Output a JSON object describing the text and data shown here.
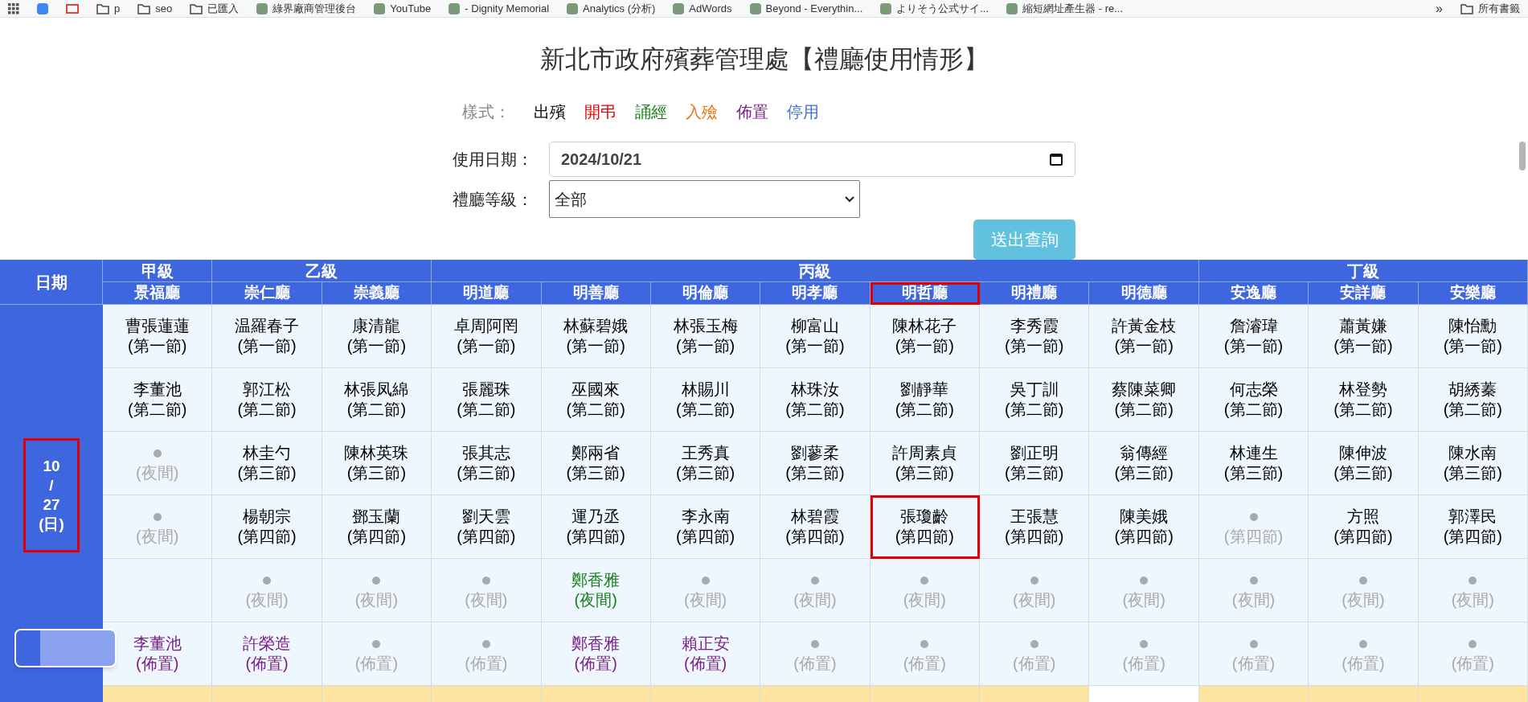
{
  "bookmarks": [
    {
      "kind": "folder",
      "label": "p"
    },
    {
      "kind": "folder",
      "label": "seo"
    },
    {
      "kind": "folder",
      "label": "已匯入"
    },
    {
      "kind": "site",
      "label": "綠界廠商管理後台"
    },
    {
      "kind": "site",
      "label": "YouTube"
    },
    {
      "kind": "site",
      "label": "- Dignity Memorial"
    },
    {
      "kind": "site",
      "label": "Analytics (分析)"
    },
    {
      "kind": "site",
      "label": "AdWords"
    },
    {
      "kind": "site",
      "label": "Beyond - Everythin..."
    },
    {
      "kind": "site",
      "label": "よりそう公式サイ..."
    },
    {
      "kind": "site",
      "label": "縮短網址產生器 - re..."
    }
  ],
  "bookmarks_more": "»",
  "bookmarks_all": "所有書籤",
  "title": "新北市政府殯葬管理處【禮廳使用情形】",
  "legend": {
    "label": "樣式：",
    "items": [
      {
        "label": "出殯",
        "color": "#000000"
      },
      {
        "label": "開弔",
        "color": "#e00000"
      },
      {
        "label": "誦經",
        "color": "#1a7f1a"
      },
      {
        "label": "入殮",
        "color": "#e8730c"
      },
      {
        "label": "佈置",
        "color": "#7a1f86"
      },
      {
        "label": "停用",
        "color": "#3a6fd8"
      }
    ]
  },
  "date_field": {
    "label": "使用日期：",
    "value": "2024/10/21"
  },
  "level_field": {
    "label": "禮廳等級：",
    "value": "全部"
  },
  "submit": "送出查詢",
  "table": {
    "date_header": "日期",
    "groups": [
      {
        "label": "甲級",
        "halls": [
          {
            "label": "景福廳",
            "highlighted": false
          }
        ]
      },
      {
        "label": "乙級",
        "halls": [
          {
            "label": "崇仁廳",
            "highlighted": false
          },
          {
            "label": "崇義廳",
            "highlighted": false
          }
        ]
      },
      {
        "label": "丙級",
        "halls": [
          {
            "label": "明道廳",
            "highlighted": false
          },
          {
            "label": "明善廳",
            "highlighted": false
          },
          {
            "label": "明倫廳",
            "highlighted": false
          },
          {
            "label": "明孝廳",
            "highlighted": false
          },
          {
            "label": "明哲廳",
            "highlighted": true
          },
          {
            "label": "明禮廳",
            "highlighted": false
          },
          {
            "label": "明德廳",
            "highlighted": false
          }
        ]
      },
      {
        "label": "丁級",
        "halls": [
          {
            "label": "安逸廳",
            "highlighted": false
          },
          {
            "label": "安詳廳",
            "highlighted": false
          },
          {
            "label": "安樂廳",
            "highlighted": false
          }
        ]
      }
    ],
    "date": {
      "lines": [
        "10",
        "/",
        "27",
        "(日)"
      ],
      "highlighted": true
    },
    "rows": [
      {
        "cells": [
          {
            "kind": "booked",
            "name": "曹張蓮蓮",
            "session": "(第一節)",
            "color": "#000000",
            "highlighted": false
          },
          {
            "kind": "booked",
            "name": "温羅春子",
            "session": "(第一節)",
            "color": "#000000",
            "highlighted": false
          },
          {
            "kind": "booked",
            "name": "康清龍",
            "session": "(第一節)",
            "color": "#000000",
            "highlighted": false
          },
          {
            "kind": "booked",
            "name": "卓周阿罔",
            "session": "(第一節)",
            "color": "#000000",
            "highlighted": false
          },
          {
            "kind": "booked",
            "name": "林蘇碧娥",
            "session": "(第一節)",
            "color": "#000000",
            "highlighted": false
          },
          {
            "kind": "booked",
            "name": "林張玉梅",
            "session": "(第一節)",
            "color": "#000000",
            "highlighted": false
          },
          {
            "kind": "booked",
            "name": "柳富山",
            "session": "(第一節)",
            "color": "#000000",
            "highlighted": false
          },
          {
            "kind": "booked",
            "name": "陳林花子",
            "session": "(第一節)",
            "color": "#000000",
            "highlighted": false
          },
          {
            "kind": "booked",
            "name": "李秀霞",
            "session": "(第一節)",
            "color": "#000000",
            "highlighted": false
          },
          {
            "kind": "booked",
            "name": "許黃金枝",
            "session": "(第一節)",
            "color": "#000000",
            "highlighted": false
          },
          {
            "kind": "booked",
            "name": "詹濬瑋",
            "session": "(第一節)",
            "color": "#000000",
            "highlighted": false
          },
          {
            "kind": "booked",
            "name": "蕭黃嫌",
            "session": "(第一節)",
            "color": "#000000",
            "highlighted": false
          },
          {
            "kind": "booked",
            "name": "陳怡勳",
            "session": "(第一節)",
            "color": "#000000",
            "highlighted": false
          }
        ]
      },
      {
        "cells": [
          {
            "kind": "booked",
            "name": "李董池",
            "session": "(第二節)",
            "color": "#000000",
            "highlighted": false
          },
          {
            "kind": "booked",
            "name": "郭江松",
            "session": "(第二節)",
            "color": "#000000",
            "highlighted": false
          },
          {
            "kind": "booked",
            "name": "林張凤綿",
            "session": "(第二節)",
            "color": "#000000",
            "highlighted": false
          },
          {
            "kind": "booked",
            "name": "張麗珠",
            "session": "(第二節)",
            "color": "#000000",
            "highlighted": false
          },
          {
            "kind": "booked",
            "name": "巫國來",
            "session": "(第二節)",
            "color": "#000000",
            "highlighted": false
          },
          {
            "kind": "booked",
            "name": "林賜川",
            "session": "(第二節)",
            "color": "#000000",
            "highlighted": false
          },
          {
            "kind": "booked",
            "name": "林珠汝",
            "session": "(第二節)",
            "color": "#000000",
            "highlighted": false
          },
          {
            "kind": "booked",
            "name": "劉靜華",
            "session": "(第二節)",
            "color": "#000000",
            "highlighted": false
          },
          {
            "kind": "booked",
            "name": "吳丁訓",
            "session": "(第二節)",
            "color": "#000000",
            "highlighted": false
          },
          {
            "kind": "booked",
            "name": "蔡陳菜卿",
            "session": "(第二節)",
            "color": "#000000",
            "highlighted": false
          },
          {
            "kind": "booked",
            "name": "何志榮",
            "session": "(第二節)",
            "color": "#000000",
            "highlighted": false
          },
          {
            "kind": "booked",
            "name": "林登勢",
            "session": "(第二節)",
            "color": "#000000",
            "highlighted": false
          },
          {
            "kind": "booked",
            "name": "胡綉蓁",
            "session": "(第二節)",
            "color": "#000000",
            "highlighted": false
          }
        ]
      },
      {
        "cells": [
          {
            "kind": "empty",
            "session": "(夜間)",
            "highlighted": false
          },
          {
            "kind": "booked",
            "name": "林圭勺",
            "session": "(第三節)",
            "color": "#000000",
            "highlighted": false
          },
          {
            "kind": "booked",
            "name": "陳林英珠",
            "session": "(第三節)",
            "color": "#000000",
            "highlighted": false
          },
          {
            "kind": "booked",
            "name": "張其志",
            "session": "(第三節)",
            "color": "#000000",
            "highlighted": false
          },
          {
            "kind": "booked",
            "name": "鄭兩省",
            "session": "(第三節)",
            "color": "#000000",
            "highlighted": false
          },
          {
            "kind": "booked",
            "name": "王秀真",
            "session": "(第三節)",
            "color": "#000000",
            "highlighted": false
          },
          {
            "kind": "booked",
            "name": "劉蓼柔",
            "session": "(第三節)",
            "color": "#000000",
            "highlighted": false
          },
          {
            "kind": "booked",
            "name": "許周素貞",
            "session": "(第三節)",
            "color": "#000000",
            "highlighted": false
          },
          {
            "kind": "booked",
            "name": "劉正明",
            "session": "(第三節)",
            "color": "#000000",
            "highlighted": false
          },
          {
            "kind": "booked",
            "name": "翁傳經",
            "session": "(第三節)",
            "color": "#000000",
            "highlighted": false
          },
          {
            "kind": "booked",
            "name": "林連生",
            "session": "(第三節)",
            "color": "#000000",
            "highlighted": false
          },
          {
            "kind": "booked",
            "name": "陳伸波",
            "session": "(第三節)",
            "color": "#000000",
            "highlighted": false
          },
          {
            "kind": "booked",
            "name": "陳水南",
            "session": "(第三節)",
            "color": "#000000",
            "highlighted": false
          }
        ]
      },
      {
        "cells": [
          {
            "kind": "empty",
            "session": "(夜間)",
            "highlighted": false
          },
          {
            "kind": "booked",
            "name": "楊朝宗",
            "session": "(第四節)",
            "color": "#000000",
            "highlighted": false
          },
          {
            "kind": "booked",
            "name": "鄧玉蘭",
            "session": "(第四節)",
            "color": "#000000",
            "highlighted": false
          },
          {
            "kind": "booked",
            "name": "劉天雲",
            "session": "(第四節)",
            "color": "#000000",
            "highlighted": false
          },
          {
            "kind": "booked",
            "name": "運乃丞",
            "session": "(第四節)",
            "color": "#000000",
            "highlighted": false
          },
          {
            "kind": "booked",
            "name": "李永南",
            "session": "(第四節)",
            "color": "#000000",
            "highlighted": false
          },
          {
            "kind": "booked",
            "name": "林碧霞",
            "session": "(第四節)",
            "color": "#000000",
            "highlighted": false
          },
          {
            "kind": "booked",
            "name": "張瓊齡",
            "session": "(第四節)",
            "color": "#000000",
            "highlighted": true
          },
          {
            "kind": "booked",
            "name": "王張慧",
            "session": "(第四節)",
            "color": "#000000",
            "highlighted": false
          },
          {
            "kind": "booked",
            "name": "陳美娥",
            "session": "(第四節)",
            "color": "#000000",
            "highlighted": false
          },
          {
            "kind": "empty",
            "session": "(第四節)",
            "highlighted": false
          },
          {
            "kind": "booked",
            "name": "方照",
            "session": "(第四節)",
            "color": "#000000",
            "highlighted": false
          },
          {
            "kind": "booked",
            "name": "郭澤民",
            "session": "(第四節)",
            "color": "#000000",
            "highlighted": false
          }
        ]
      },
      {
        "cells": [
          {
            "kind": "blank",
            "highlighted": false
          },
          {
            "kind": "empty",
            "session": "(夜間)",
            "highlighted": false
          },
          {
            "kind": "empty",
            "session": "(夜間)",
            "highlighted": false
          },
          {
            "kind": "empty",
            "session": "(夜間)",
            "highlighted": false
          },
          {
            "kind": "booked",
            "name": "鄭香雅",
            "session": "(夜間)",
            "color": "#1a7f1a",
            "highlighted": false
          },
          {
            "kind": "empty",
            "session": "(夜間)",
            "highlighted": false
          },
          {
            "kind": "empty",
            "session": "(夜間)",
            "highlighted": false
          },
          {
            "kind": "empty",
            "session": "(夜間)",
            "highlighted": false
          },
          {
            "kind": "empty",
            "session": "(夜間)",
            "highlighted": false
          },
          {
            "kind": "empty",
            "session": "(夜間)",
            "highlighted": false
          },
          {
            "kind": "empty",
            "session": "(夜間)",
            "highlighted": false
          },
          {
            "kind": "empty",
            "session": "(夜間)",
            "highlighted": false
          },
          {
            "kind": "empty",
            "session": "(夜間)",
            "highlighted": false
          }
        ]
      },
      {
        "cells": [
          {
            "kind": "booked",
            "name": "李董池",
            "session": "(佈置)",
            "color": "#7a1f86",
            "highlighted": false
          },
          {
            "kind": "booked",
            "name": "許榮造",
            "session": "(佈置)",
            "color": "#7a1f86",
            "highlighted": false
          },
          {
            "kind": "empty",
            "session": "(佈置)",
            "highlighted": false
          },
          {
            "kind": "empty",
            "session": "(佈置)",
            "highlighted": false
          },
          {
            "kind": "booked",
            "name": "鄭香雅",
            "session": "(佈置)",
            "color": "#7a1f86",
            "highlighted": false
          },
          {
            "kind": "booked",
            "name": "賴正安",
            "session": "(佈置)",
            "color": "#7a1f86",
            "highlighted": false
          },
          {
            "kind": "empty",
            "session": "(佈置)",
            "highlighted": false
          },
          {
            "kind": "empty",
            "session": "(佈置)",
            "highlighted": false
          },
          {
            "kind": "empty",
            "session": "(佈置)",
            "highlighted": false
          },
          {
            "kind": "empty",
            "session": "(佈置)",
            "highlighted": false
          },
          {
            "kind": "empty",
            "session": "(佈置)",
            "highlighted": false
          },
          {
            "kind": "empty",
            "session": "(佈置)",
            "highlighted": false
          },
          {
            "kind": "empty",
            "session": "(佈置)",
            "highlighted": false
          }
        ]
      }
    ],
    "next_row": [
      {
        "color": "#fde4a0"
      },
      {
        "color": "#fde4a0"
      },
      {
        "color": "#fde4a0"
      },
      {
        "color": "#fde4a0"
      },
      {
        "color": "#fde4a0"
      },
      {
        "color": "#fde4a0"
      },
      {
        "color": "#fde4a0"
      },
      {
        "color": "#fde4a0"
      },
      {
        "color": "#fde4a0"
      },
      {
        "color": "#ffffff"
      },
      {
        "color": "#fde4a0"
      },
      {
        "color": "#fde4a0"
      },
      {
        "color": "#fde4a0"
      }
    ]
  }
}
